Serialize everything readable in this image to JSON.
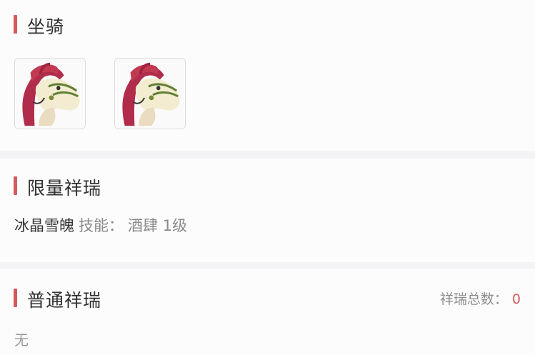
{
  "mount_section": {
    "title": "坐骑",
    "items": [
      {
        "icon": "horse-mount-icon"
      },
      {
        "icon": "horse-mount-icon"
      }
    ]
  },
  "limited_section": {
    "title": "限量祥瑞",
    "item_name": "冰晶雪魄",
    "skill_label": "技能：",
    "skill_value": "酒肆 1级"
  },
  "normal_section": {
    "title": "普通祥瑞",
    "count_label": "祥瑞总数：",
    "count_value": "0",
    "empty_text": "无"
  },
  "colors": {
    "accent": "#d15b5b",
    "background": "#f4f3f5",
    "card": "#fdfcfd"
  }
}
